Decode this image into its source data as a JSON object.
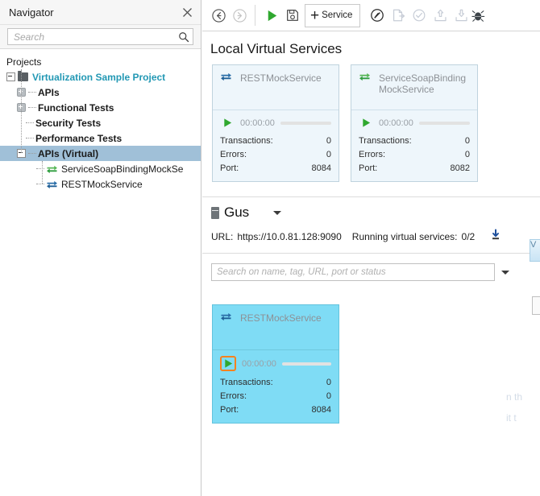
{
  "navigator": {
    "title": "Navigator",
    "close_icon": "close-icon",
    "search": {
      "value": "",
      "placeholder": "Search",
      "icon": "search-icon"
    },
    "tree": {
      "root_label": "Projects",
      "items": [
        {
          "label": "Virtualization Sample Project",
          "level": 1,
          "toggle": "minus",
          "icon": "folder-icon",
          "style": "project",
          "selected": false
        },
        {
          "label": "APIs",
          "level": 2,
          "toggle": "plus",
          "icon": "none",
          "style": "bold",
          "selected": false
        },
        {
          "label": "Functional Tests",
          "level": 2,
          "toggle": "plus",
          "icon": "none",
          "style": "bold",
          "selected": false
        },
        {
          "label": "Security Tests",
          "level": 2,
          "toggle": "none",
          "icon": "none",
          "style": "bold",
          "selected": false
        },
        {
          "label": "Performance Tests",
          "level": 2,
          "toggle": "none",
          "icon": "none",
          "style": "bold",
          "selected": false
        },
        {
          "label": "APIs (Virtual)",
          "level": 2,
          "toggle": "minus",
          "icon": "none",
          "style": "bold",
          "selected": true
        },
        {
          "label": "ServiceSoapBindingMockSe",
          "level": 3,
          "toggle": "none",
          "icon": "virtual-service-green-icon",
          "style": "plain",
          "selected": false
        },
        {
          "label": "RESTMockService",
          "level": 3,
          "toggle": "none",
          "icon": "virtual-service-blue-icon",
          "style": "plain",
          "selected": false
        }
      ]
    }
  },
  "toolbar": {
    "buttons": [
      {
        "name": "back-button",
        "icon": "arrow-left-circle-icon",
        "enabled": true
      },
      {
        "name": "forward-button",
        "icon": "arrow-right-circle-icon",
        "enabled": false
      },
      {
        "name": "run-button",
        "icon": "play-icon",
        "enabled": true
      },
      {
        "name": "save-button",
        "icon": "floppy-disk-icon",
        "enabled": true
      }
    ],
    "service_button": {
      "label": "Service",
      "icon": "plus-icon"
    },
    "right_buttons": [
      {
        "name": "pencil-circle-button",
        "icon": "pencil-circle-icon",
        "enabled": true
      },
      {
        "name": "export-report-button",
        "icon": "file-export-icon",
        "enabled": false
      },
      {
        "name": "validate-button",
        "icon": "check-circle-icon",
        "enabled": false
      },
      {
        "name": "upload-button",
        "icon": "upload-tray-icon",
        "enabled": false
      },
      {
        "name": "download-button",
        "icon": "download-tray-icon",
        "enabled": false
      },
      {
        "name": "bug-button",
        "icon": "bug-icon",
        "enabled": true
      }
    ]
  },
  "local_services": {
    "title": "Local Virtual Services",
    "labels": {
      "transactions": "Transactions:",
      "errors": "Errors:",
      "port": "Port:"
    },
    "cards": [
      {
        "name": "RESTMockService",
        "icon": "virtual-service-blue-icon",
        "timer": "00:00:00",
        "transactions": "0",
        "errors": "0",
        "port": "8084",
        "selected": false,
        "play_highlighted": false
      },
      {
        "name": "ServiceSoapBinding MockService",
        "icon": "virtual-service-green-icon",
        "timer": "00:00:00",
        "transactions": "0",
        "errors": "0",
        "port": "8082",
        "selected": false,
        "play_highlighted": false
      }
    ]
  },
  "agent": {
    "name": "Gus",
    "icon": "server-icon",
    "dropdown_icon": "chevron-down-icon",
    "url_label": "URL:",
    "url_value": "https://10.0.81.128:9090",
    "running_label": "Running virtual services:",
    "running_value": "0/2",
    "download_icon": "download-icon",
    "side_button_label": "V"
  },
  "filter": {
    "value": "",
    "placeholder": "Search on name, tag, URL, port or status",
    "dropdown_icon": "chevron-down-icon"
  },
  "remote_services": {
    "labels": {
      "transactions": "Transactions:",
      "errors": "Errors:",
      "port": "Port:"
    },
    "cards": [
      {
        "name": "RESTMockService",
        "icon": "virtual-service-blue-icon",
        "timer": "00:00:00",
        "transactions": "0",
        "errors": "0",
        "port": "8084",
        "selected": true,
        "play_highlighted": true
      }
    ]
  },
  "clipped_text": {
    "line1": "n th",
    "line2": "it t"
  },
  "colors": {
    "accent_blue": "#2298b4",
    "selection_blue": "#a0c0d8",
    "card_selected": "#7fdcf5",
    "highlight_orange": "#f5821f",
    "play_green": "#2fa82f"
  }
}
